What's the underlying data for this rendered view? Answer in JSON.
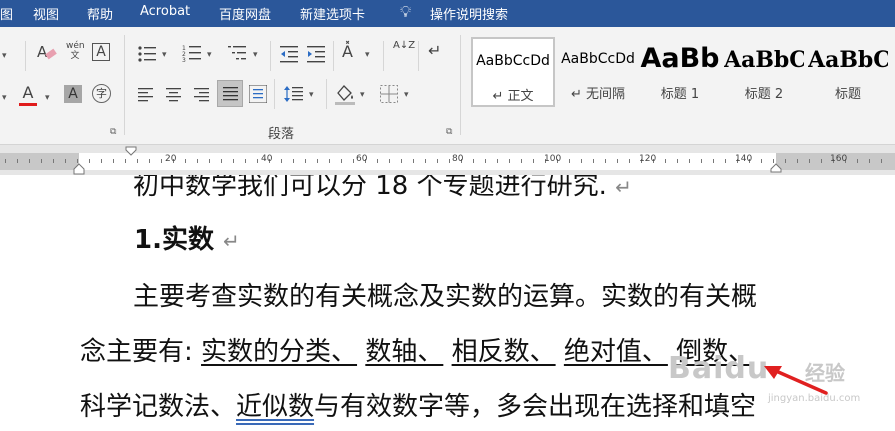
{
  "menu": {
    "items": [
      "图",
      "视图",
      "帮助",
      "Acrobat",
      "百度网盘",
      "新建选项卡"
    ],
    "search_label": "操作说明搜索"
  },
  "ribbon": {
    "paragraph_group_label": "段落",
    "phonetic_glyph": "wén\n文",
    "font_color_glyph": "A",
    "shading_glyph": "A",
    "enclose_glyph": "字",
    "sort_glyph": "A↓Z",
    "styles": [
      {
        "sample": "AaBbCcDd",
        "name": "↵ 正文",
        "selected": true
      },
      {
        "sample": "AaBbCcDd",
        "name": "↵ 无间隔",
        "selected": false
      },
      {
        "sample": "AaBb",
        "name": "标题 1",
        "selected": false
      },
      {
        "sample": "AaBbC",
        "name": "标题 2",
        "selected": false
      },
      {
        "sample": "AaBbC",
        "name": "标题",
        "selected": false
      }
    ]
  },
  "ruler": {
    "labels": [
      "20",
      "40",
      "60",
      "80",
      "100",
      "120",
      "140",
      "160"
    ]
  },
  "document": {
    "line1": "初中数学我们可以分 18 个专题进行研究.",
    "line1_mark": "↵",
    "heading": "1.实数",
    "heading_mark": "↵",
    "para1": "主要考查实数的有关概念及实数的运算。实数的有关概",
    "para2_prefix": "念主要有: ",
    "para2_terms": [
      "实数的分类、",
      "数轴、",
      "相反数、",
      "绝对值、",
      "倒数、"
    ],
    "para3_prefix": "科学记数法、",
    "para3_link": "近似数",
    "para3_rest": "与有效数字等，多会出现在选择和填空"
  },
  "watermark": {
    "brand": "Baidu",
    "cn": "经验",
    "url": "jingyan.baidu.com"
  },
  "colors": {
    "menubar": "#2b579a",
    "font_color_underline": "#e01b1b",
    "arrow": "#e02020"
  }
}
